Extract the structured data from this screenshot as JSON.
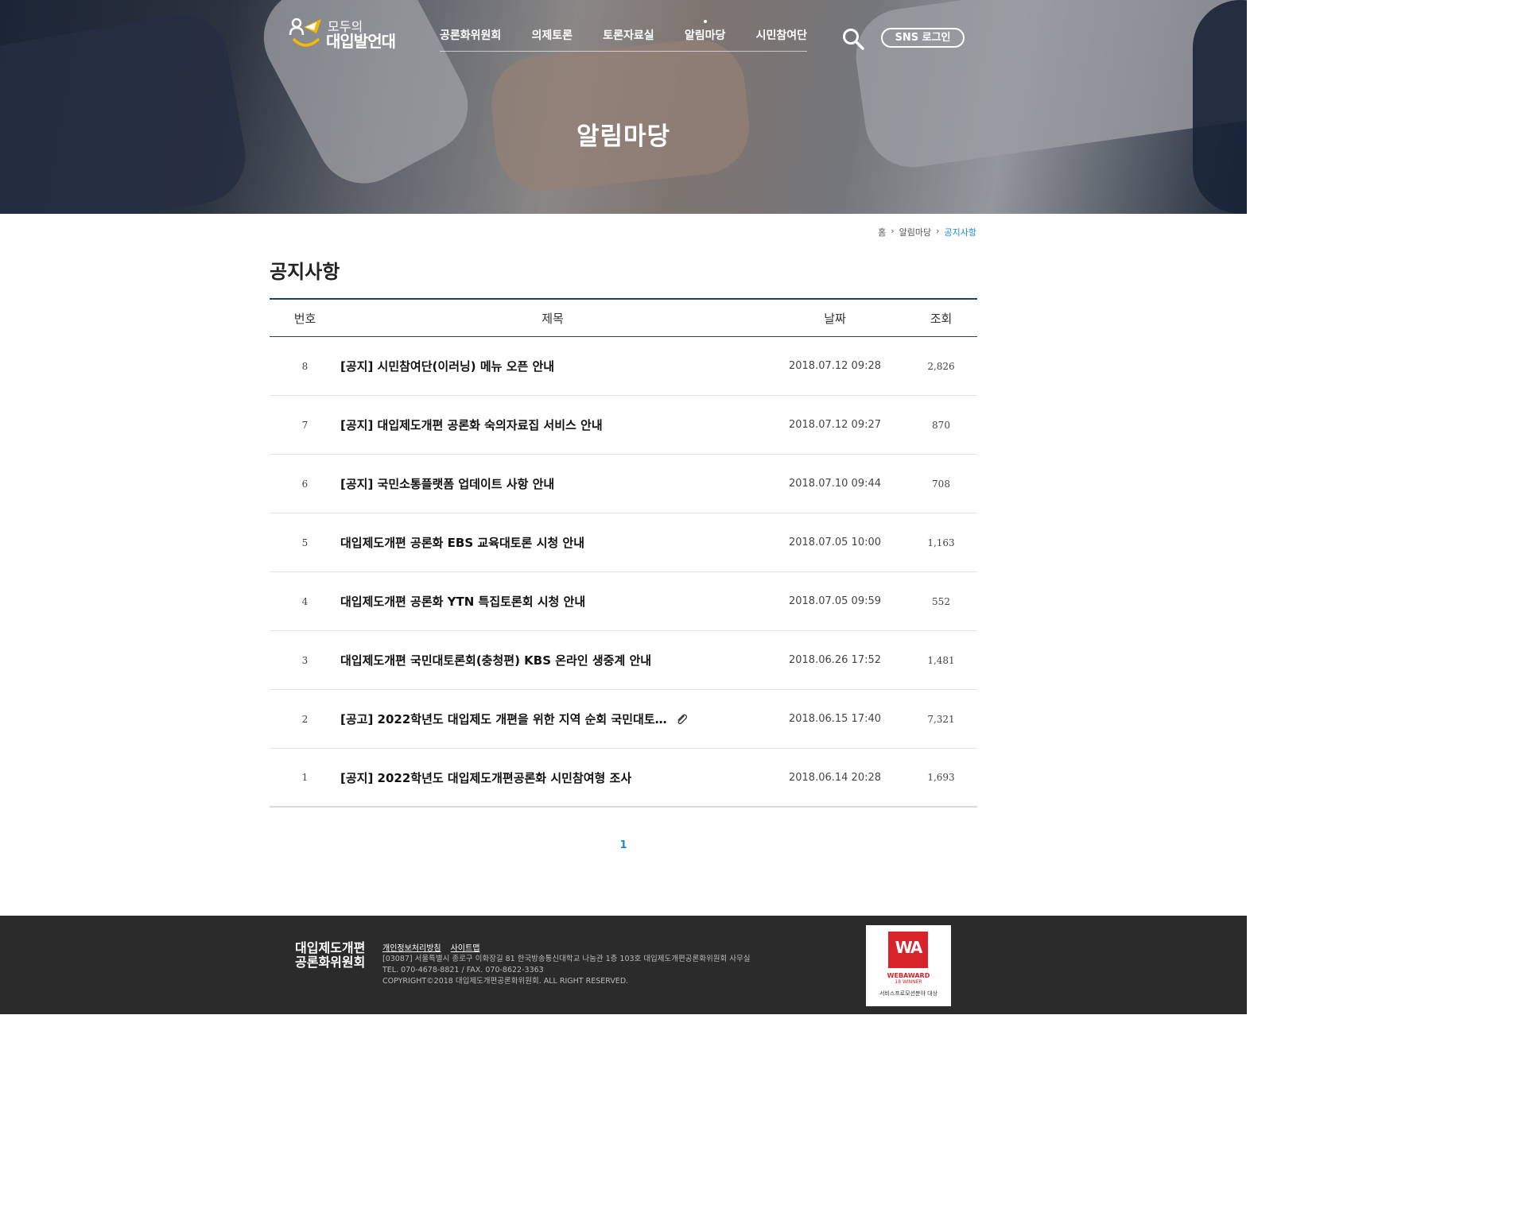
{
  "header": {
    "logo_top": "모두의",
    "logo_main": "대입발언대",
    "nav": [
      {
        "label": "공론화위원회"
      },
      {
        "label": "의제토론"
      },
      {
        "label": "토론자료실"
      },
      {
        "label": "알림마당",
        "active": true
      },
      {
        "label": "시민참여단"
      }
    ],
    "search_icon": "search-icon",
    "sns_login_label": "SNS 로그인"
  },
  "hero": {
    "title": "알림마당"
  },
  "breadcrumb": {
    "home": "홈",
    "section": "알림마당",
    "current": "공지사항"
  },
  "page_title": "공지사항",
  "board": {
    "columns": {
      "num": "번호",
      "title": "제목",
      "date": "날짜",
      "hits": "조회"
    },
    "rows": [
      {
        "num": "8",
        "title": "[공지] 시민참여단(이러닝) 메뉴 오픈 안내",
        "date": "2018.07.12 09:28",
        "hits": "2,826"
      },
      {
        "num": "7",
        "title": "[공지] 대입제도개편 공론화 숙의자료집 서비스 안내",
        "date": "2018.07.12 09:27",
        "hits": "870"
      },
      {
        "num": "6",
        "title": "[공지] 국민소통플랫폼 업데이트 사항 안내",
        "date": "2018.07.10 09:44",
        "hits": "708"
      },
      {
        "num": "5",
        "title": "대입제도개편 공론화 EBS 교육대토론 시청 안내",
        "date": "2018.07.05 10:00",
        "hits": "1,163"
      },
      {
        "num": "4",
        "title": "대입제도개편 공론화 YTN 특집토론회 시청 안내",
        "date": "2018.07.05 09:59",
        "hits": "552"
      },
      {
        "num": "3",
        "title": "대입제도개편 국민대토론회(충청편) KBS 온라인 생중계 안내",
        "date": "2018.06.26 17:52",
        "hits": "1,481"
      },
      {
        "num": "2",
        "title": "[공고] 2022학년도 대입제도 개편을 위한 지역 순회 국민대토…",
        "date": "2018.06.15 17:40",
        "hits": "7,321",
        "attachment": true
      },
      {
        "num": "1",
        "title": "[공지] 2022학년도 대입제도개편공론화 시민참여형 조사",
        "date": "2018.06.14 20:28",
        "hits": "1,693"
      }
    ]
  },
  "pagination": {
    "current": "1"
  },
  "footer": {
    "logo_line1": "대입제도개편",
    "logo_line2": "공론화위원회",
    "links": [
      "개인정보처리방침",
      "사이트맵"
    ],
    "address": "[03087] 서울특별시 종로구 이화장길 81 한국방송통신대학교 나눔관 1층 103호 대입제도개편공론화위원회 사무실",
    "contact": "TEL. 070-4678-8821 / FAX. 070-8622-3363",
    "copyright": "COPYRIGHT©2018 대입제도개편공론화위원회. ALL RIGHT RESERVED.",
    "award": {
      "mark": "WA",
      "line1": "WEBAWARD",
      "line2": "18 WINNER",
      "line3": "서비스프로모션분야 대상"
    }
  },
  "colors": {
    "accent": "#1a8bd6",
    "table_border": "#1f3f63",
    "footer_bg": "#2b2b2b",
    "award_red": "#d8232a",
    "logo_yellow": "#f5b800"
  }
}
